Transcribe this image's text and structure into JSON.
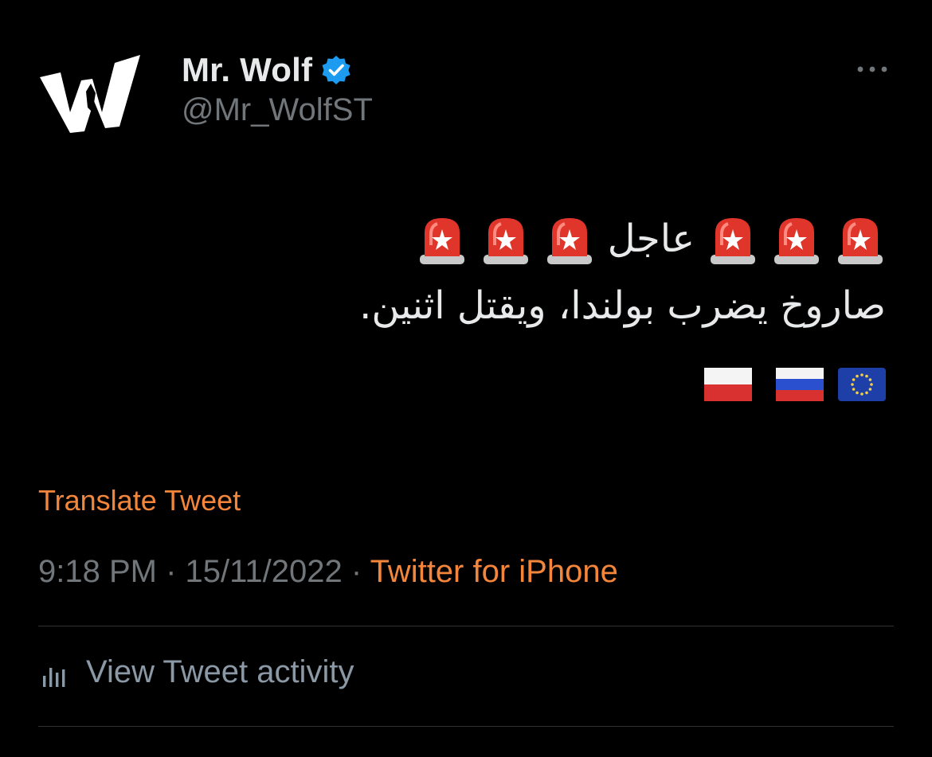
{
  "author": {
    "name": "Mr. Wolf",
    "handle": "@Mr_WolfST",
    "avatar_letter": "W",
    "verified_color": "#1d9bf0"
  },
  "tweet": {
    "word_urgent": "عاجل",
    "siren_icon": "police-car-light-emoji",
    "body_line": "صاروخ يضرب بولندا، ويقتل اثنين.",
    "flags": [
      "flag-poland",
      "flag-russia",
      "flag-eu"
    ]
  },
  "translate_label": "Translate Tweet",
  "meta": {
    "time": "9:18 PM",
    "separator": " · ",
    "date": "15/11/2022",
    "source": "Twitter for iPhone"
  },
  "activity_label": "View Tweet activity",
  "colors": {
    "background": "#000000",
    "text": "#e7e9ea",
    "muted": "#71767b",
    "accent": "#f4863c",
    "divider": "#2f3336"
  }
}
